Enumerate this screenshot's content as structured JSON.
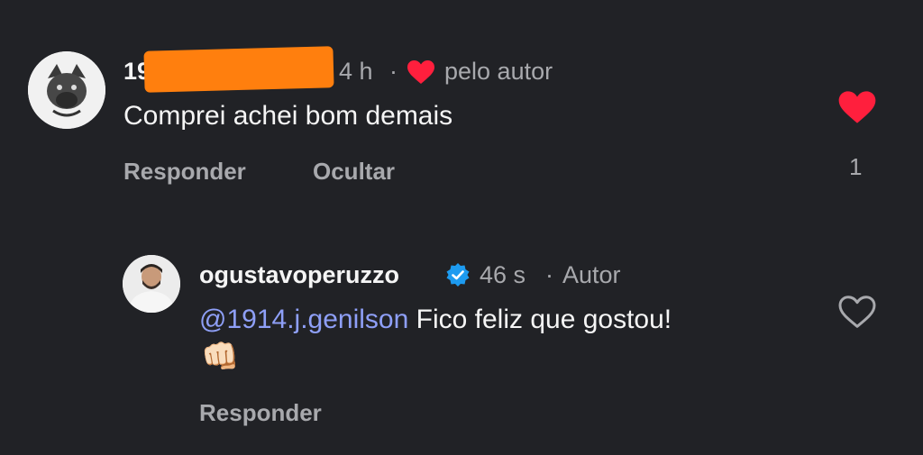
{
  "comment": {
    "username_visible": "19",
    "time": "4 h",
    "separator": "·",
    "liked_by_author_text": "pelo autor",
    "text": "Comprei achei bom demais",
    "reply_label": "Responder",
    "hide_label": "Ocultar",
    "like_count": "1",
    "colors": {
      "redaction": "#ff7f0e",
      "heart": "#ff1f3d"
    }
  },
  "reply": {
    "username": "ogustavoperuzzo",
    "verified": true,
    "time": "46 s",
    "separator": "·",
    "author_tag": "Autor",
    "mention": "@1914.j.genilson",
    "text": "Fico feliz que gostou!",
    "emoji": "👊🏻",
    "reply_label": "Responder",
    "colors": {
      "mention": "#8e9ff7",
      "verified": "#1d9bf0"
    }
  }
}
